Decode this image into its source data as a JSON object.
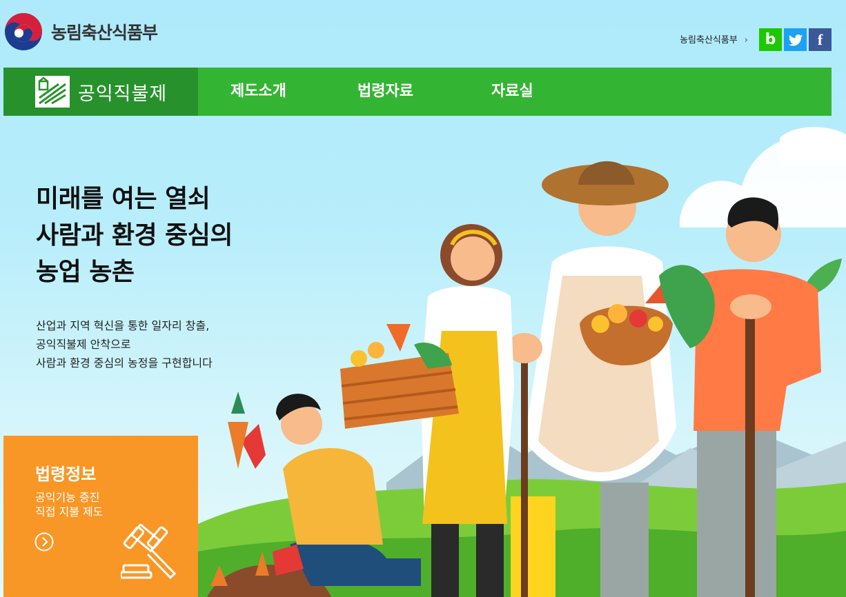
{
  "header": {
    "logo_text": "농림축산식품부",
    "ministry_link": "농림축산식품부",
    "social": [
      {
        "label": "b",
        "icon": "blog-icon",
        "color": "#1ec800"
      },
      {
        "label": "",
        "icon": "twitter-icon",
        "color": "#1da1f2"
      },
      {
        "label": "f",
        "icon": "facebook-icon",
        "color": "#3b5998"
      }
    ]
  },
  "nav": {
    "brand": "공익직불제",
    "items": [
      "제도소개",
      "법령자료",
      "자료실"
    ],
    "colors": {
      "bar": "#33b533",
      "brand_bg": "#27922b"
    }
  },
  "hero": {
    "headline": [
      "미래를 여는 열쇠",
      "사람과 환경 중심의",
      "농업 농촌"
    ],
    "description": [
      "산업과 지역 혁신을 통한 일자리 창출,",
      "공익직불제 안착으로",
      "사람과 환경 중심의 농정을 구현합니다"
    ]
  },
  "law_card": {
    "title": "법령정보",
    "desc": [
      "공익기능 증진",
      "직접 지불 제도"
    ],
    "color": "#f89726"
  }
}
